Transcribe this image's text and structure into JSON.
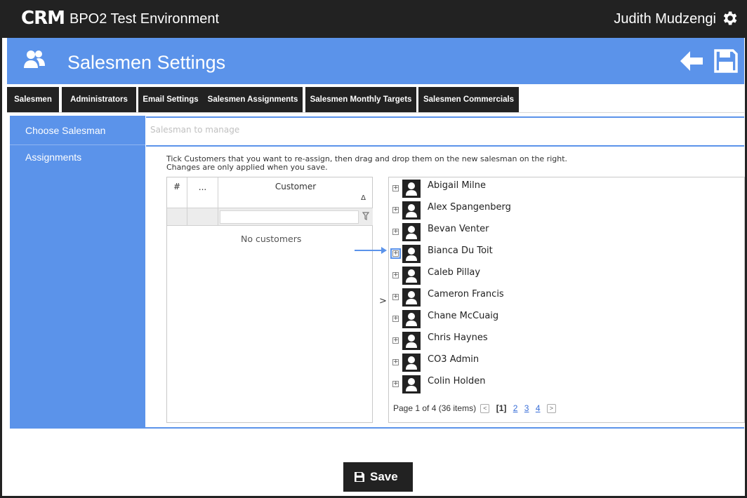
{
  "header": {
    "logo": "CRM",
    "app_title": "BPO2 Test Environment",
    "user_name": "Judith Mudzengi",
    "settings_icon": "gear-icon"
  },
  "page": {
    "title": "Salesmen Settings",
    "icon": "users-icon",
    "back_icon": "arrow-left-icon",
    "save_icon": "floppy-disk-icon"
  },
  "tabs": [
    {
      "label": "Salesmen"
    },
    {
      "label": "Administrators"
    },
    {
      "label": "Email Settings"
    },
    {
      "label": "Salesmen Assignments"
    },
    {
      "label": "Salesmen Monthly Targets"
    },
    {
      "label": "Salesmen Commercials"
    }
  ],
  "sidebar": {
    "items": [
      {
        "label": "Choose Salesman"
      },
      {
        "label": "Assignments"
      }
    ]
  },
  "choose_salesman": {
    "placeholder": "Salesman to manage"
  },
  "assignments": {
    "instruction_line1": "Tick Customers that you want to re-assign, then drag and drop them on the new salesman on the right.",
    "instruction_line2": "Changes are only applied when you save.",
    "grid": {
      "columns": [
        "#",
        "...",
        "Customer"
      ],
      "sort_indicator": "Δ",
      "empty_text": "No customers"
    },
    "expander": ">",
    "salesmen": [
      {
        "name": "Abigail Milne"
      },
      {
        "name": "Alex Spangenberg"
      },
      {
        "name": "Bevan Venter"
      },
      {
        "name": "Bianca Du Toit"
      },
      {
        "name": "Caleb Pillay"
      },
      {
        "name": "Cameron Francis"
      },
      {
        "name": "Chane McCuaig"
      },
      {
        "name": "Chris Haynes"
      },
      {
        "name": "CO3 Admin"
      },
      {
        "name": "Colin Holden"
      }
    ],
    "pager": {
      "summary": "Page 1 of 4 (36 items)",
      "current": "[1]",
      "pages": [
        "2",
        "3",
        "4"
      ]
    }
  },
  "footer": {
    "save_label": "Save"
  },
  "colors": {
    "accent": "#5b93ea",
    "dark": "#222222"
  }
}
